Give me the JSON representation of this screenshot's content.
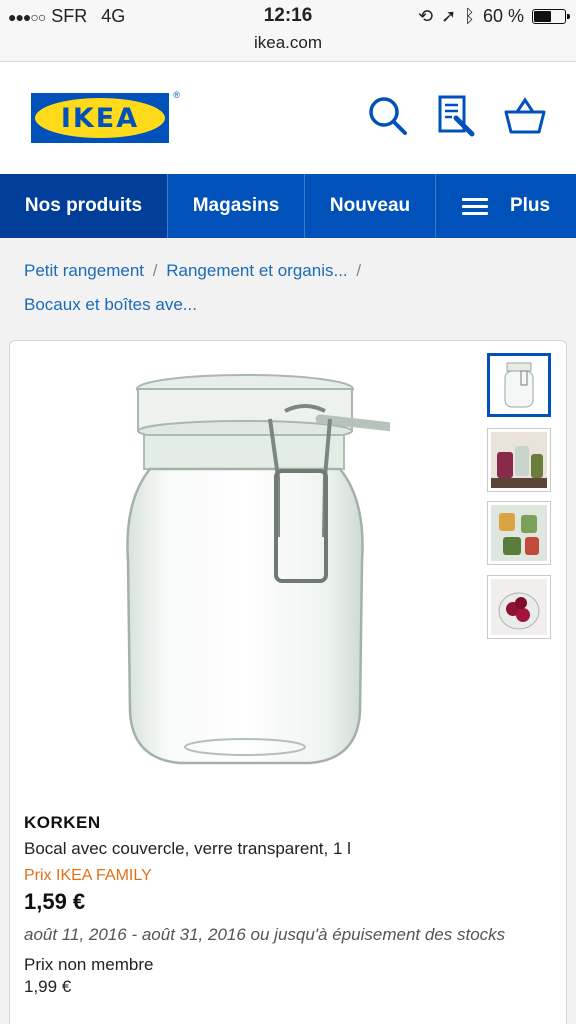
{
  "status_bar": {
    "carrier": "SFR",
    "network": "4G",
    "time": "12:16",
    "battery": "60 %",
    "battery_level": 0.6
  },
  "url": "ikea.com",
  "header": {
    "logo_text": "IKEA",
    "logo_reg": "®",
    "icons": [
      "search-icon",
      "shopping-list-icon",
      "basket-icon"
    ]
  },
  "nav": {
    "items": [
      "Nos produits",
      "Magasins",
      "Nouveau",
      "Plus"
    ]
  },
  "breadcrumb": {
    "items": [
      "Petit rangement",
      "Rangement et organis...",
      "Bocaux et boîtes ave..."
    ],
    "separator": "/"
  },
  "product": {
    "name": "KORKEN",
    "description": "Bocal avec couvercle, verre transparent, 1 l",
    "family_label": "Prix IKEA FAMILY",
    "price": "1,59 €",
    "dates": "août 11, 2016 - août 31, 2016 ou jusqu'à épuisement des stocks",
    "non_member_label": "Prix non membre",
    "non_member_price": "1,99 €"
  },
  "colors": {
    "brand_blue": "#0051ba",
    "brand_yellow": "#ffda1a",
    "link": "#1a6bb8",
    "family_orange": "#e0701a"
  }
}
